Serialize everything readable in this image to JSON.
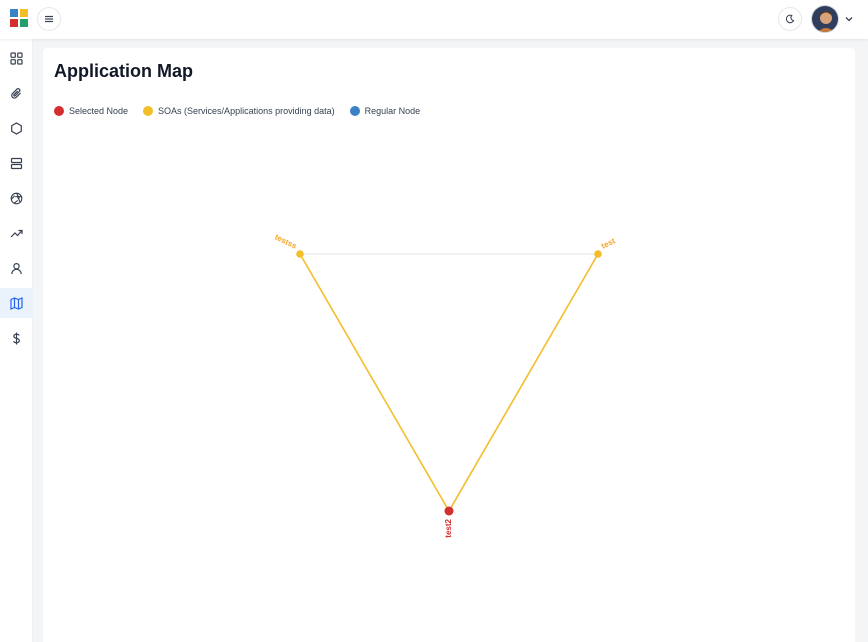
{
  "header": {
    "menu_icon": "hamburger-icon",
    "theme_icon": "moon-icon",
    "user_menu_icon": "chevron-down-icon"
  },
  "sidebar": {
    "items": [
      {
        "icon": "grid-icon",
        "active": false
      },
      {
        "icon": "paperclip-icon",
        "active": false
      },
      {
        "icon": "hexagon-icon",
        "active": false
      },
      {
        "icon": "server-icon",
        "active": false
      },
      {
        "icon": "aperture-icon",
        "active": false
      },
      {
        "icon": "trending-up-icon",
        "active": false
      },
      {
        "icon": "user-icon",
        "active": false
      },
      {
        "icon": "map-icon",
        "active": true
      },
      {
        "icon": "dollar-icon",
        "active": false
      }
    ]
  },
  "page": {
    "title": "Application Map"
  },
  "legend": {
    "selected": "Selected Node",
    "soa": "SOAs (Services/Applications providing data)",
    "regular": "Regular Node"
  },
  "colors": {
    "selected": "#d32f2f",
    "soa": "#f2be2a",
    "regular": "#3b82c4",
    "soa_label": "#f5a623",
    "plain_edge": "#e5e7eb",
    "active_nav": "#2563eb"
  },
  "graph": {
    "nodes": [
      {
        "id": "testss",
        "label": "testss",
        "type": "soa"
      },
      {
        "id": "test",
        "label": "test",
        "type": "soa"
      },
      {
        "id": "test2",
        "label": "test2",
        "type": "selected"
      }
    ],
    "edges": [
      {
        "from": "testss",
        "to": "test",
        "style": "plain"
      },
      {
        "from": "testss",
        "to": "test2",
        "style": "soa"
      },
      {
        "from": "test",
        "to": "test2",
        "style": "soa"
      }
    ]
  }
}
